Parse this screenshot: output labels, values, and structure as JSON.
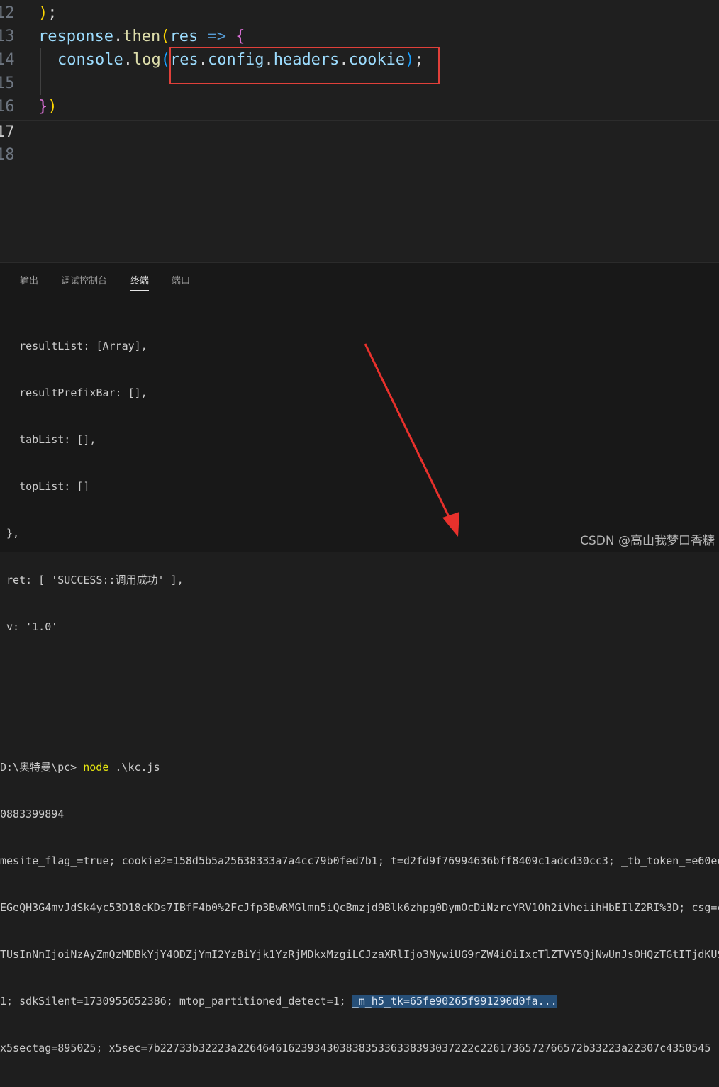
{
  "editor": {
    "lines": [
      {
        "num": "12",
        "code": ");"
      },
      {
        "num": "13",
        "code": "response.then(res => {"
      },
      {
        "num": "14",
        "code": "console.log(res.config.headers.cookie);"
      },
      {
        "num": "15",
        "code": ""
      },
      {
        "num": "16",
        "code": "})"
      },
      {
        "num": "17",
        "code": ""
      },
      {
        "num": "18",
        "code": ""
      }
    ],
    "tokens": {
      "l12_paren": ")",
      "l12_semi": ";",
      "l13_response": "response",
      "l13_dot": ".",
      "l13_then": "then",
      "l13_open": "(",
      "l13_res": "res",
      "l13_arrow": " => ",
      "l13_brace": "{",
      "l14_console": "console",
      "l14_dot1": ".",
      "l14_log": "log",
      "l14_open": "(",
      "l14_res": "res",
      "l14_dot2": ".",
      "l14_config": "config",
      "l14_dot3": ".",
      "l14_headers": "headers",
      "l14_dot4": ".",
      "l14_cookie": "cookie",
      "l14_close": ")",
      "l14_semi": ";",
      "l16_brace": "}",
      "l16_paren": ")"
    }
  },
  "panel": {
    "tabs": [
      {
        "label": "输出",
        "active": false
      },
      {
        "label": "调试控制台",
        "active": false
      },
      {
        "label": "终端",
        "active": true
      },
      {
        "label": "端口",
        "active": false
      }
    ],
    "terminal": {
      "lines": [
        "   resultList: [Array],",
        "   resultPrefixBar: [],",
        "   tabList: [],",
        "   topList: []",
        " },",
        " ret: [ 'SUCCESS::调用成功' ],",
        " v: '1.0'",
        "",
        "",
        "0883399894",
        "mesite_flag_=true; cookie2=158d5b5a25638333a7a4cc79b0fed7b1; t=d2fd9f76994636bff8409c1adcd30cc3; _tb_token_=e60ee",
        "EGeQH3G4mvJdSk4yc53D18cKDs7IBfF4b0%2FcJfp3BwRMGlmn5iQcBmzjd9Blk6zhpg0DymOcDiNzrcYRV1Oh2iVheiihHbEIlZ2RI%3D; csg=c",
        "TUsInNnIjoiNzAyZmQzMDBkYjY4ODZjYmI2YzBiYjk1YzRjMDkxMzgiLCJzaXRlIjo3NywiUG9rZW4iOiIxcTlZTVY5QjNwUnJsOHQzTGtITjdKUS"
      ],
      "prompt": "D:\\奥特曼\\pc> ",
      "command_node": "node",
      "command_arg": " .\\kc.js",
      "last_line_prefix": "1; sdkSilent=1730955652386; mtop_partitioned_detect=1; ",
      "last_line_selected": "_m_h5_tk=65fe90265f991290d0fa",
      "last_line_suffix": "...",
      "cut_line": "x5sectag=895025; x5sec=7b22733b32223a2264646162393430383835336338393037222c2261736572766572b33223a22307c4350545"
    }
  },
  "watermark": "CSDN @高山我梦口香糖",
  "colors": {
    "highlight_box": "#e0403a",
    "arrow": "#e8312c"
  }
}
